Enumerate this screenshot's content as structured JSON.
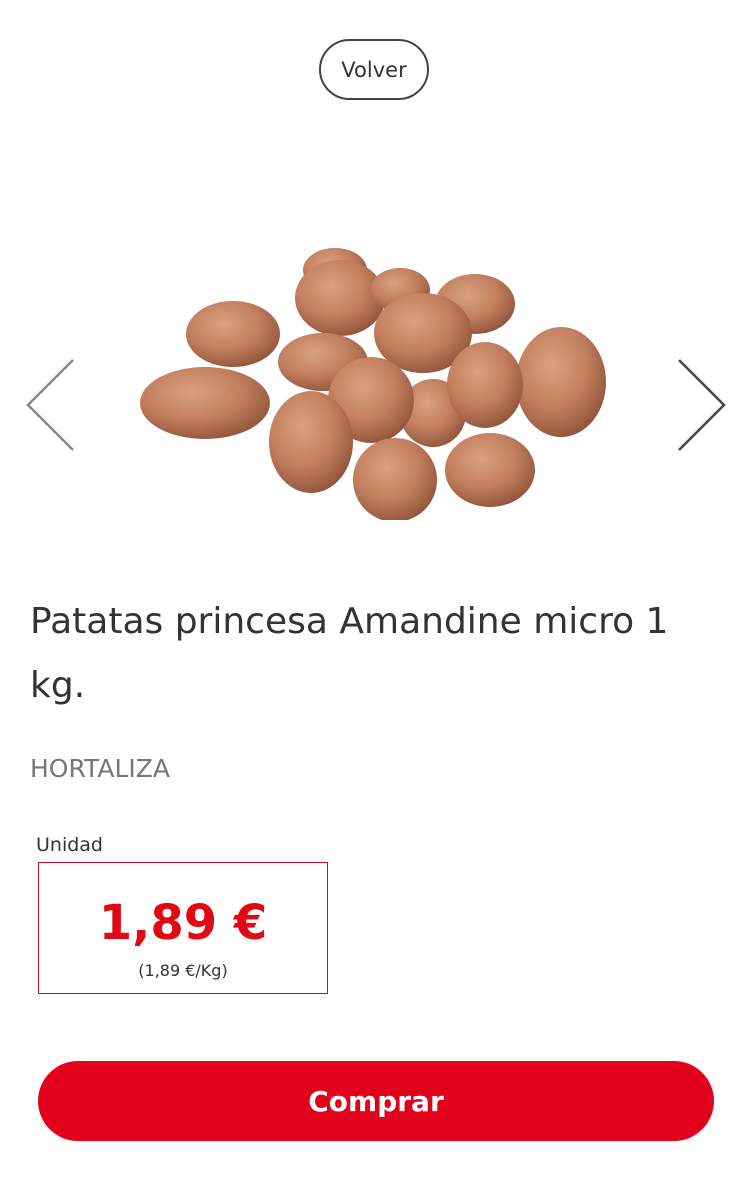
{
  "header": {
    "back_label": "Volver"
  },
  "carousel": {
    "prev_icon": "chevron-left-icon",
    "next_icon": "chevron-right-icon"
  },
  "product": {
    "title": "Patatas princesa Amandine micro 1 kg.",
    "category": "HORTALIZA",
    "unit_label": "Unidad",
    "price": "1,89 €",
    "price_per_kg": "(1,89 €/Kg)"
  },
  "actions": {
    "buy_label": "Comprar"
  },
  "colors": {
    "accent": "#e3001b",
    "price": "#e30613",
    "text": "#333333",
    "muted": "#777777"
  }
}
